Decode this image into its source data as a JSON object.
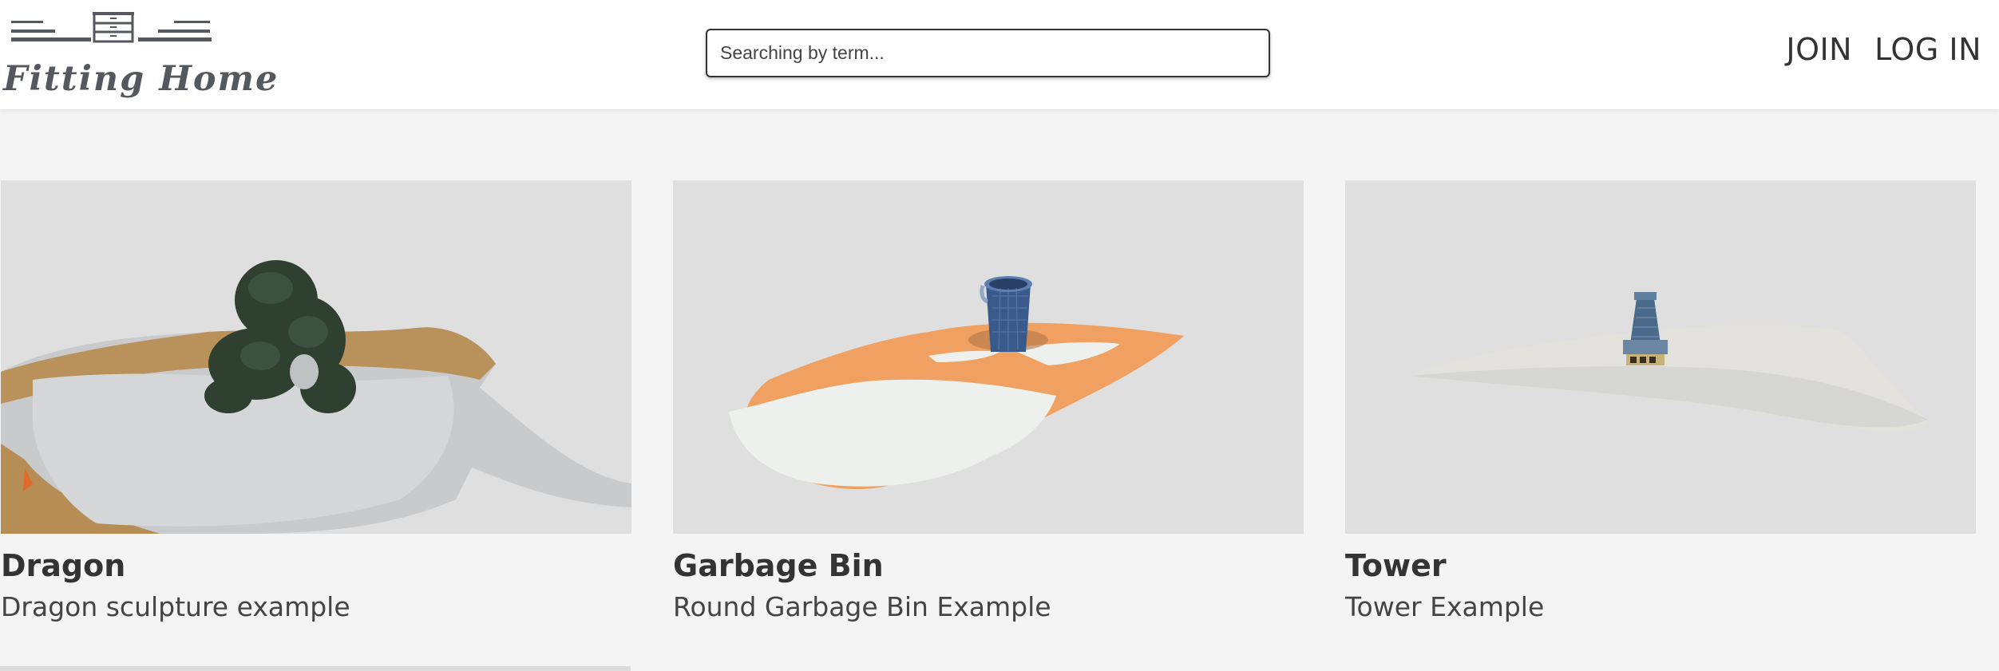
{
  "header": {
    "logo_text": "Fitting Home",
    "search": {
      "placeholder": "Searching by term...",
      "value": ""
    },
    "nav": {
      "join": "JOIN",
      "login": "LOG IN"
    }
  },
  "products": [
    {
      "title": "Dragon",
      "description": "Dragon sculpture example",
      "image": "dragon-scan-model"
    },
    {
      "title": "Garbage Bin",
      "description": "Round Garbage Bin Example",
      "image": "garbage-bin-scan-model"
    },
    {
      "title": "Tower",
      "description": "Tower Example",
      "image": "tower-scan-model"
    }
  ],
  "colors": {
    "page_background": "#f4f4f4",
    "header_background": "#ffffff",
    "thumbnail_background": "#dfdfdf",
    "logo": "#55585e",
    "text": "#333333",
    "accent_orange": "#f0a060",
    "bin_blue": "#3b5a8c"
  }
}
